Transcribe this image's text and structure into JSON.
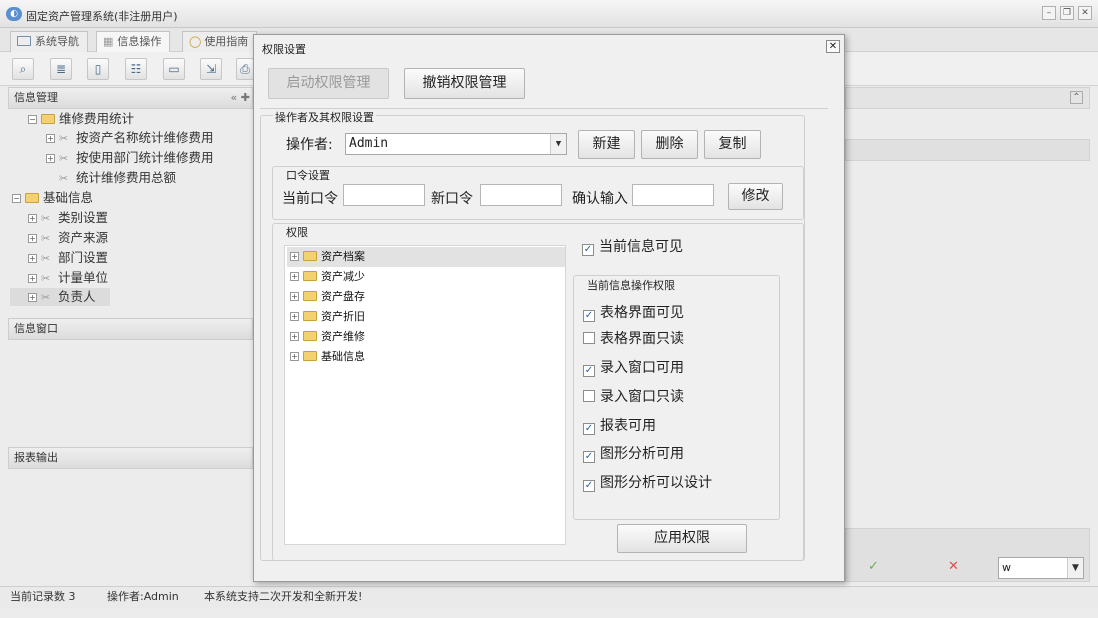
{
  "app": {
    "title": "固定资产管理系统(非注册用户)"
  },
  "tabs": [
    {
      "label": "系统导航",
      "icon": "monitor-icon"
    },
    {
      "label": "信息操作",
      "icon": "grid-icon"
    },
    {
      "label": "使用指南",
      "icon": "clock-icon"
    }
  ],
  "left": {
    "panel_title": "信息管理",
    "tree": [
      {
        "label": "维修费用统计",
        "level": 1,
        "type": "folder",
        "expanded": true
      },
      {
        "label": "按资产名称统计维修费用",
        "level": 2,
        "type": "tool",
        "expander": true
      },
      {
        "label": "按使用部门统计维修费用",
        "level": 2,
        "type": "tool",
        "expander": true
      },
      {
        "label": "统计维修费用总额",
        "level": 2,
        "type": "tool",
        "expander": false
      },
      {
        "label": "基础信息",
        "level": 0,
        "type": "folder",
        "expanded": true
      },
      {
        "label": "类别设置",
        "level": 1,
        "type": "tool",
        "expander": true
      },
      {
        "label": "资产来源",
        "level": 1,
        "type": "tool",
        "expander": true
      },
      {
        "label": "部门设置",
        "level": 1,
        "type": "tool",
        "expander": true
      },
      {
        "label": "计量单位",
        "level": 1,
        "type": "tool",
        "expander": true
      },
      {
        "label": "负责人",
        "level": 1,
        "type": "tool",
        "expander": true,
        "selected": true
      }
    ],
    "info_window_title": "信息窗口",
    "report_title": "报表输出"
  },
  "right": {
    "select_value": "w",
    "confirm_icon": "check-icon",
    "cancel_icon": "x-icon"
  },
  "status": {
    "records": "当前记录数 3",
    "operator": "操作者:Admin",
    "message": "本系统支持二次开发和全新开发!"
  },
  "dialog": {
    "title": "权限设置",
    "enable_button": "启动权限管理",
    "revoke_button": "撤销权限管理",
    "operator_group": "操作者及其权限设置",
    "operator_label": "操作者:",
    "operator_value": "Admin",
    "new_button": "新建",
    "delete_button": "删除",
    "copy_button": "复制",
    "password_group": "口令设置",
    "current_pw_label": "当前口令",
    "new_pw_label": "新口令",
    "confirm_pw_label": "确认输入",
    "modify_button": "修改",
    "permission_group": "权限",
    "perm_tree": [
      "资产档案",
      "资产减少",
      "资产盘存",
      "资产折旧",
      "资产维修",
      "基础信息"
    ],
    "current_visible": {
      "label": "当前信息可见",
      "checked": true
    },
    "ops_group": "当前信息操作权限",
    "ops": [
      {
        "label": "表格界面可见",
        "checked": true
      },
      {
        "label": "表格界面只读",
        "checked": false
      },
      {
        "label": "录入窗口可用",
        "checked": true
      },
      {
        "label": "录入窗口只读",
        "checked": false
      },
      {
        "label": "报表可用",
        "checked": true
      },
      {
        "label": "图形分析可用",
        "checked": true
      },
      {
        "label": "图形分析可以设计",
        "checked": true
      }
    ],
    "apply_button": "应用权限"
  }
}
